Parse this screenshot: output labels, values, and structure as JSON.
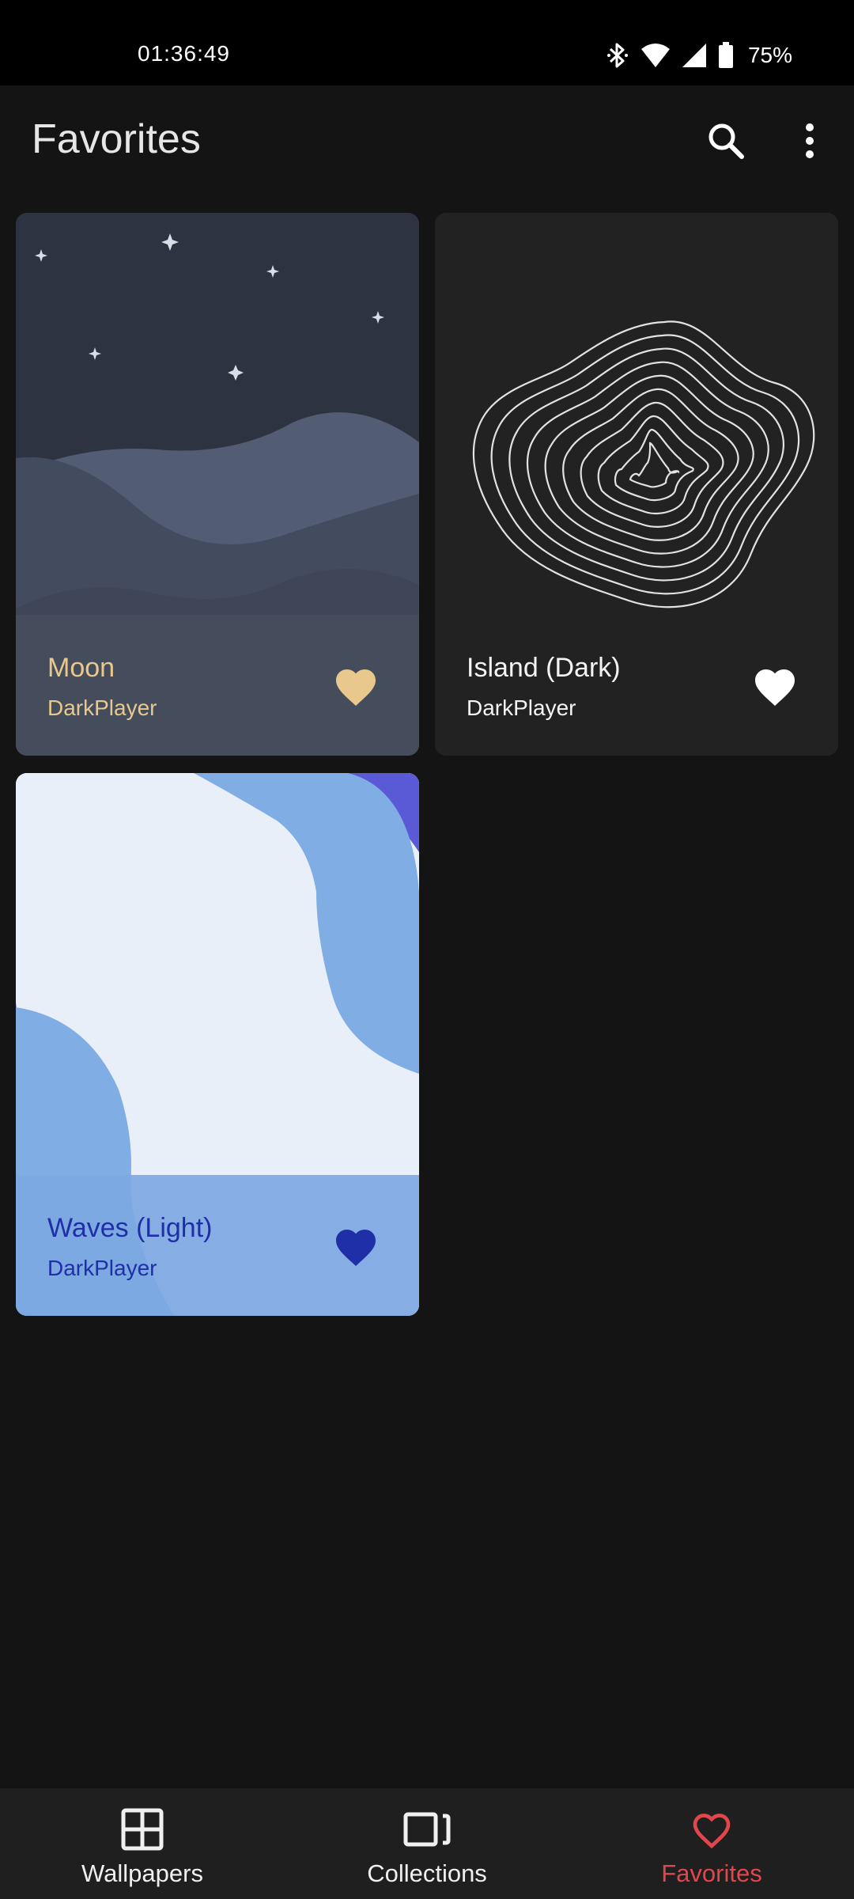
{
  "status_bar": {
    "time": "01:36:49",
    "battery_percent": "75%",
    "battery_level": 0.75
  },
  "header": {
    "title": "Favorites",
    "search_icon": "search-icon",
    "more_icon": "more-vert-icon"
  },
  "wallpapers": [
    {
      "title": "Moon",
      "author": "DarkPlayer",
      "favorited": true,
      "accent_color": "#e8c88c"
    },
    {
      "title": "Island (Dark)",
      "author": "DarkPlayer",
      "favorited": true,
      "accent_color": "#f4f4f4"
    },
    {
      "title": "Waves (Light)",
      "author": "DarkPlayer",
      "favorited": true,
      "accent_color": "#1f2fa8"
    }
  ],
  "bottom_nav": {
    "items": [
      {
        "label": "Wallpapers",
        "icon": "grid-icon",
        "active": false
      },
      {
        "label": "Collections",
        "icon": "collections-icon",
        "active": false
      },
      {
        "label": "Favorites",
        "icon": "heart-outline-icon",
        "active": true
      }
    ],
    "active_color": "#e0474d"
  }
}
